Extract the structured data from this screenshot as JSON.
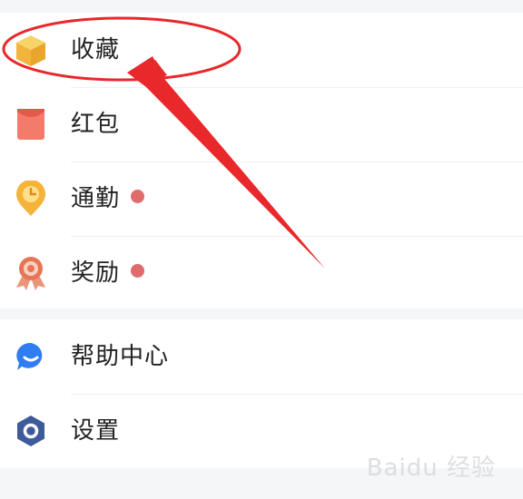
{
  "menu": {
    "items": [
      {
        "label": "收藏",
        "icon": "favorites-box-icon",
        "badge": false
      },
      {
        "label": "红包",
        "icon": "red-envelope-icon",
        "badge": true
      },
      {
        "label": "通勤",
        "icon": "commute-clock-icon",
        "badge": true
      },
      {
        "label": "奖励",
        "icon": "reward-medal-icon",
        "badge": true
      },
      {
        "label": "帮助中心",
        "icon": "help-chat-icon",
        "badge": false
      },
      {
        "label": "设置",
        "icon": "settings-hex-icon",
        "badge": false
      }
    ]
  },
  "watermark": "Baidu 经验",
  "colors": {
    "annotation_red": "#e8282b",
    "badge_red": "#e06b6b",
    "favorites_yellow": "#f4c14a",
    "envelope_red": "#f06a5a",
    "commute_orange": "#f5b33a",
    "reward_orange": "#e77657",
    "help_blue": "#2f7df0",
    "settings_navy": "#3d5a9a"
  }
}
